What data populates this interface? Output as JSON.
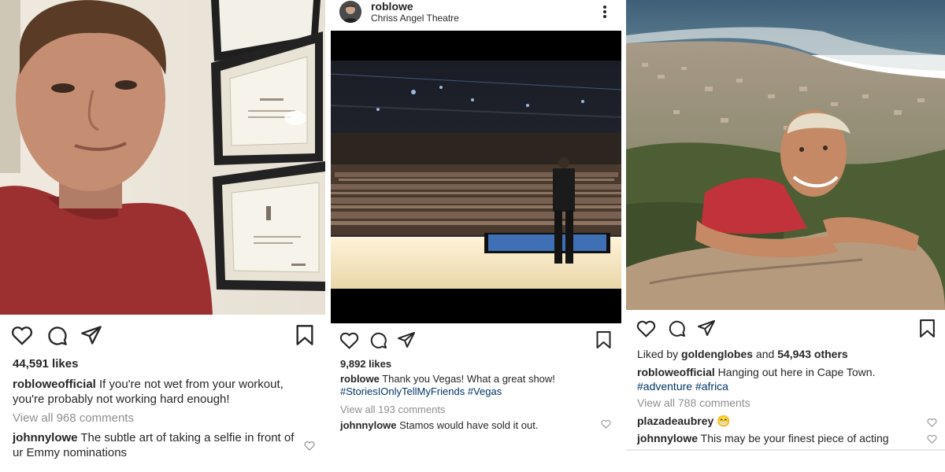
{
  "posts": [
    {
      "likes": "44,591 likes",
      "caption_user": "robloweofficial",
      "caption_text": " If you're not wet from your workout, you're probably not working hard enough!",
      "view_all": "View all 968 comments",
      "comments": [
        {
          "user": "johnnylowe",
          "text": " The subtle art of taking a selfie in front of ur Emmy nominations"
        }
      ]
    },
    {
      "username": "roblowe",
      "location": "Chriss Angel Theatre",
      "likes": "9,892 likes",
      "caption_user": "roblowe",
      "caption_text": " Thank you Vegas! What a great show!",
      "caption_tags": "#StoriesIOnlyTellMyFriends #Vegas",
      "view_all": "View all 193 comments",
      "comments": [
        {
          "user": "johnnylowe",
          "text": " Stamos would have sold it out."
        }
      ]
    },
    {
      "liked_by_prefix": "Liked by ",
      "liked_by_user": "goldenglobes",
      "liked_by_middle": " and ",
      "liked_by_count": "54,943 others",
      "caption_user": "robloweofficial",
      "caption_text": " Hanging out here in Cape Town.",
      "caption_tags": "#adventure #africa",
      "view_all": "View all 788 comments",
      "comments": [
        {
          "user": "plazadeaubrey",
          "text": " 😁"
        },
        {
          "user": "johnnylowe",
          "text": " This may be your finest piece of acting"
        }
      ]
    }
  ],
  "colors": {
    "text": "#262626",
    "muted": "#8e8e8e",
    "hashtag": "#003569",
    "divider": "#e9e9e9"
  },
  "icons": [
    "heart-icon",
    "comment-icon",
    "share-icon",
    "bookmark-icon",
    "more-options-icon"
  ]
}
